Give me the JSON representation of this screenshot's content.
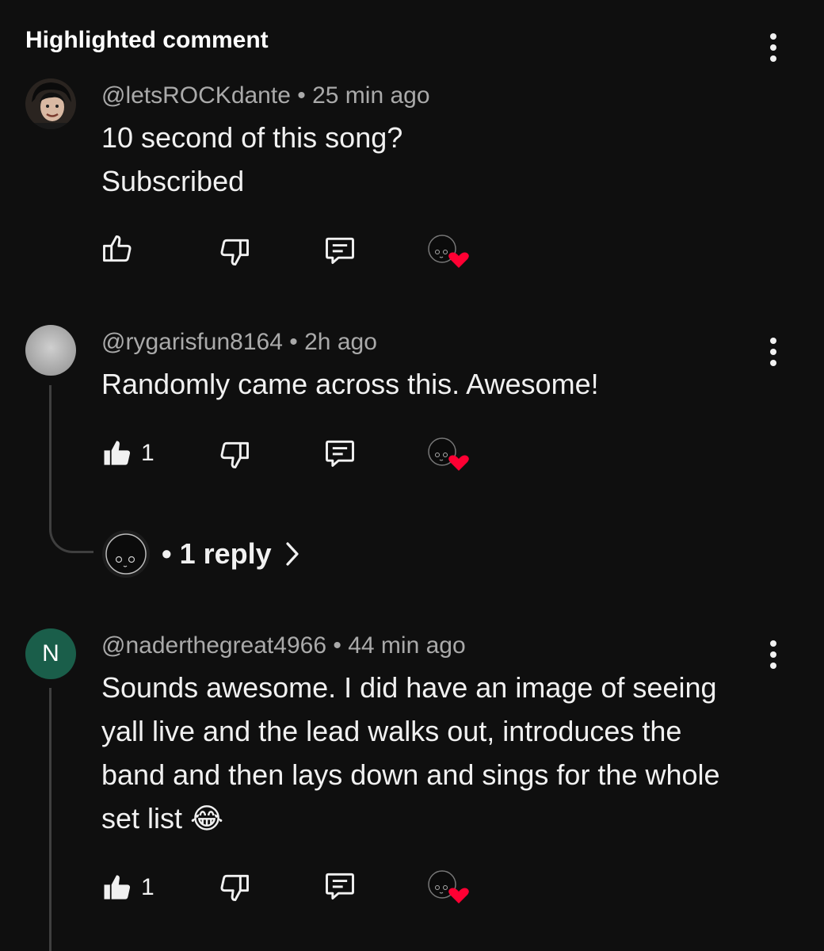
{
  "header": {
    "title": "Highlighted comment"
  },
  "comments": [
    {
      "author": "@letsROCKdante",
      "separator": "•",
      "time": "25 min ago",
      "text_lines": [
        "10 second of this song?",
        "Subscribed"
      ],
      "likes": "",
      "liked": false,
      "avatar_icon": "person-photo-avatar",
      "hearted": true
    },
    {
      "author": "@rygarisfun8164",
      "separator": "•",
      "time": "2h ago",
      "text_lines": [
        "Randomly came across this. Awesome!"
      ],
      "likes": "1",
      "liked": true,
      "avatar_icon": "gray-circle-avatar",
      "hearted": true,
      "replies": {
        "bullet": "•",
        "label": "1 reply"
      }
    },
    {
      "author": "@naderthegreat4966",
      "separator": "•",
      "time": "44 min ago",
      "text_lines": [
        "Sounds awesome. I did have an image of seeing",
        "yall live and the lead walks out, introduces the",
        "band and then lays down and sings for the whole",
        "set list 😂"
      ],
      "likes": "1",
      "liked": true,
      "avatar_letter": "N",
      "avatar_color": "#1a5e4a",
      "hearted": true
    }
  ],
  "colors": {
    "background": "#0f0f0f",
    "text_primary": "#f1f1f1",
    "text_secondary": "#aaaaaa",
    "heart": "#ff0033",
    "thread_line": "#3f3f3f"
  },
  "icons": {
    "like": "thumbs-up-icon",
    "dislike": "thumbs-down-icon",
    "reply": "reply-comment-icon",
    "creator_heart": "creator-heart-icon",
    "more": "more-vertical-icon",
    "chevron": "chevron-right-icon"
  }
}
